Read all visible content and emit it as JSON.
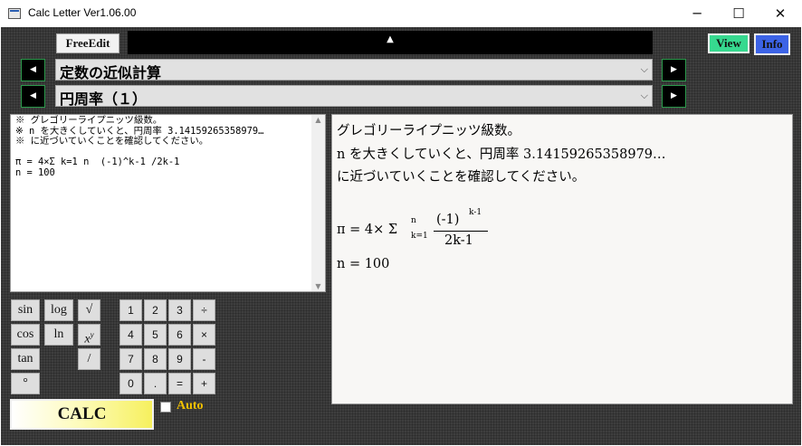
{
  "window": {
    "title": "Calc Letter  Ver1.06.00",
    "minimize": "─",
    "maximize": "☐",
    "close": "✕"
  },
  "toolbar": {
    "free_edit": "FreeEdit",
    "collapse_arrow": "▲",
    "view": "View",
    "info": "Info"
  },
  "category": {
    "selected": "定数の近似計算",
    "chevron": "⌵",
    "prev_arrow": "◀",
    "next_arrow": "▶"
  },
  "item": {
    "selected": "円周率（１）",
    "chevron": "⌵",
    "prev_arrow": "◀",
    "next_arrow": "▶"
  },
  "editor": {
    "lines": [
      "※ グレゴリーライプニッツ級数。",
      "※ n を大きくしていくと、円周率 3.14159265358979…",
      "※ に近づいていくことを確認してください。",
      "",
      "π = 4×Σ k=1 n  (-1)^k-1 /2k-1",
      "n = 100"
    ],
    "scroll_up": "▲",
    "scroll_down": "▼"
  },
  "preview": {
    "line1": "グレゴリーライプニッツ級数。",
    "line2": "n を大きくしていくと、円周率  3.14159265358979…",
    "line3": "に近づいていくことを確認してください。",
    "formula": {
      "lhs": "π  =  4×  Σ",
      "sum_upper": "n",
      "sum_lower": "k=1",
      "numerator": "(-1)",
      "exponent": "k-1",
      "denominator": "2k-1"
    },
    "line_n": "n  =  100"
  },
  "keypad": {
    "functions": {
      "sin": "sin",
      "log": "log",
      "sqrt": "√",
      "cos": "cos",
      "ln": "ln",
      "pow_base": "x",
      "pow_exp": "y",
      "tan": "tan",
      "frac": "/",
      "degree": "°"
    },
    "numbers": {
      "k1": "1",
      "k2": "2",
      "k3": "3",
      "div": "÷",
      "k4": "4",
      "k5": "5",
      "k6": "6",
      "mul": "×",
      "k7": "7",
      "k8": "8",
      "k9": "9",
      "sub": "-",
      "k0": "0",
      "dot": ".",
      "eq": "=",
      "add": "+"
    }
  },
  "actions": {
    "calc": "CALC",
    "auto_label": "Auto",
    "auto_checked": false
  }
}
